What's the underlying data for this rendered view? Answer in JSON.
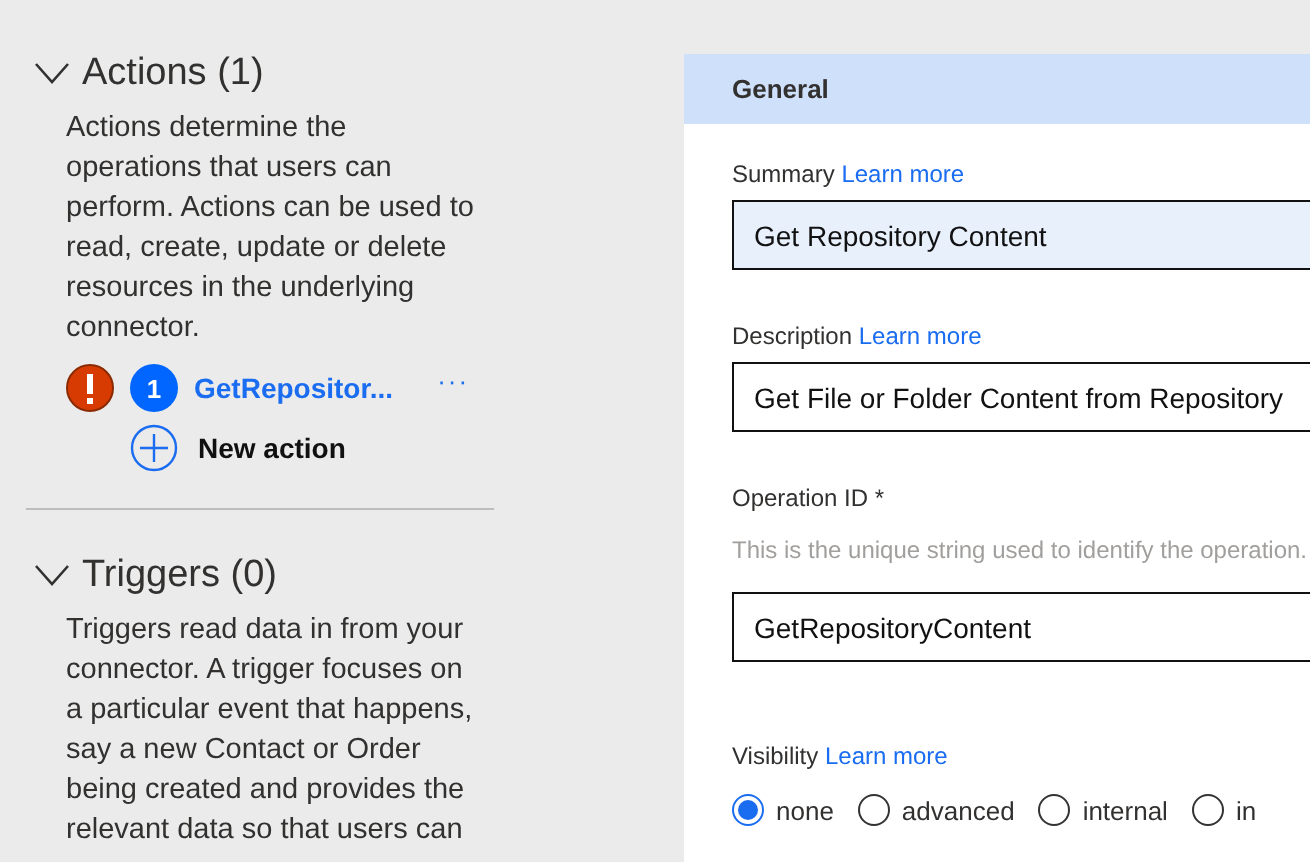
{
  "sidebar": {
    "sections": [
      {
        "title": "Actions (1)",
        "expanded": true,
        "description": "Actions determine the operations that users can perform. Actions can be used to read, create, update or delete resources in the underlying connector.",
        "items": [
          {
            "error": true,
            "number": "1",
            "name": "GetRepositor...",
            "more": "···"
          }
        ],
        "add_label": "New action"
      },
      {
        "title": "Triggers (0)",
        "expanded": true,
        "description": "Triggers read data in from your connector. A trigger focuses on a particular event that happens, say a new Contact or Order being created and provides the relevant data so that users can"
      }
    ]
  },
  "panel": {
    "header": "General",
    "fields": [
      {
        "kind": "text",
        "label": "Summary",
        "link": "Learn more",
        "value": "Get Repository Content",
        "focused": true
      },
      {
        "kind": "text",
        "label": "Description",
        "link": "Learn more",
        "value": "Get File or Folder Content from Repository",
        "focused": false
      },
      {
        "kind": "text",
        "label": "Operation ID *",
        "hint": "This is the unique string used to identify the operation.",
        "value": "GetRepositoryContent",
        "focused": false
      },
      {
        "kind": "radio",
        "label": "Visibility",
        "link": "Learn more",
        "options": [
          {
            "label": "none",
            "selected": true
          },
          {
            "label": "advanced",
            "selected": false
          },
          {
            "label": "internal",
            "selected": false
          },
          {
            "label": "in",
            "selected": false
          }
        ]
      }
    ]
  }
}
